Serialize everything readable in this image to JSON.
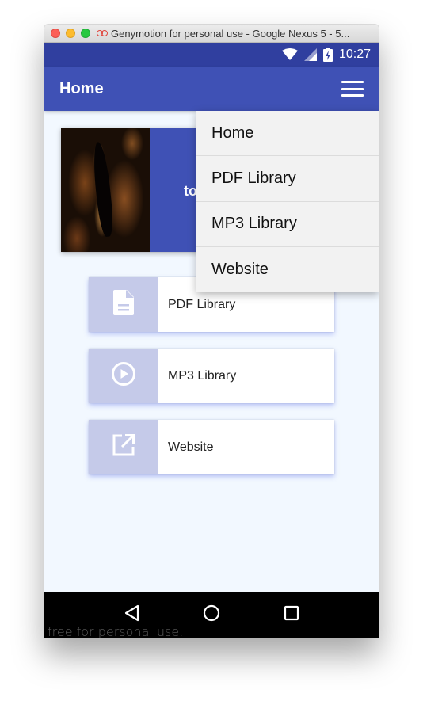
{
  "window": {
    "title": "Genymotion for personal use - Google Nexus 5 - 5...",
    "watermark": "free for personal use."
  },
  "statusbar": {
    "time": "10:27",
    "icons": [
      "wifi-icon",
      "signal-icon",
      "battery-charging-icon"
    ]
  },
  "toolbar": {
    "title": "Home",
    "menu_icon": "hamburger-menu-icon"
  },
  "banner": {
    "visible_text": "to"
  },
  "cards": [
    {
      "label": "PDF Library",
      "icon": "document-icon"
    },
    {
      "label": "MP3 Library",
      "icon": "play-circle-icon"
    },
    {
      "label": "Website",
      "icon": "open-external-icon"
    }
  ],
  "menu": {
    "items": [
      {
        "label": "Home"
      },
      {
        "label": "PDF Library"
      },
      {
        "label": "MP3 Library"
      },
      {
        "label": "Website"
      }
    ]
  },
  "navbar": {
    "icons": [
      "back-icon",
      "home-icon",
      "recents-icon"
    ]
  },
  "colors": {
    "primary": "#3f51b5",
    "primary_dark": "#303f9f",
    "accent_light": "#c5cae9",
    "background": "#f2f8ff"
  }
}
